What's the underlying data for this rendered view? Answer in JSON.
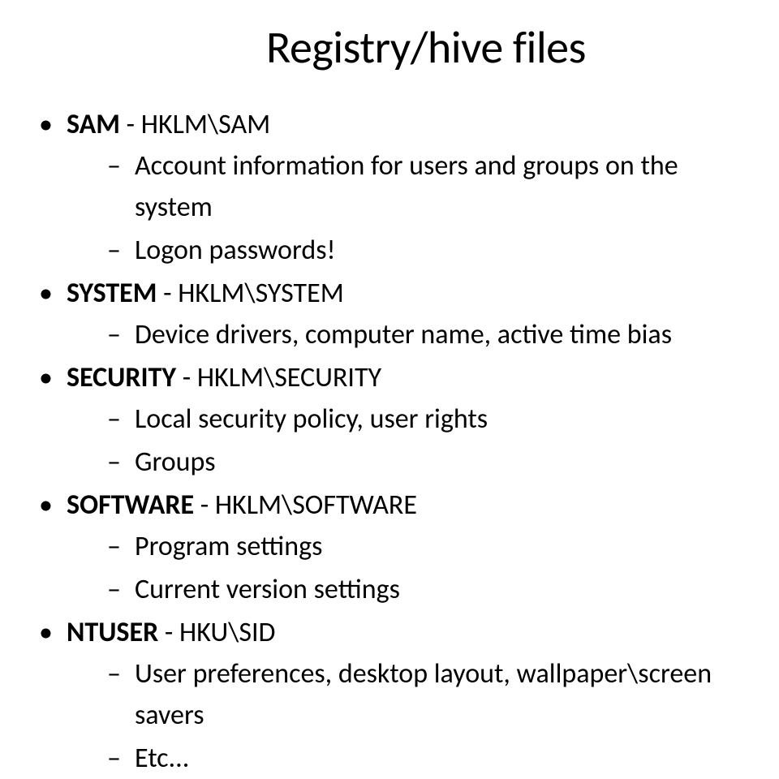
{
  "title": "Registry/hive files",
  "items": [
    {
      "heading_bold": "SAM",
      "heading_rest": " - HKLM\\SAM",
      "subs": [
        "Account information for users and groups on the system",
        "Logon passwords!"
      ]
    },
    {
      "heading_bold": "SYSTEM",
      "heading_rest": " - HKLM\\SYSTEM",
      "subs": [
        "Device drivers, computer name, active time bias"
      ]
    },
    {
      "heading_bold": "SECURITY",
      "heading_rest": " - HKLM\\SECURITY",
      "subs": [
        "Local security policy, user rights",
        "Groups"
      ]
    },
    {
      "heading_bold": "SOFTWARE",
      "heading_rest": " - HKLM\\SOFTWARE",
      "subs": [
        "Program settings",
        "Current version settings"
      ]
    },
    {
      "heading_bold": "NTUSER",
      "heading_rest": " - HKU\\SID",
      "subs": [
        "User preferences, desktop layout, wallpaper\\screen savers",
        "Etc..."
      ]
    }
  ]
}
